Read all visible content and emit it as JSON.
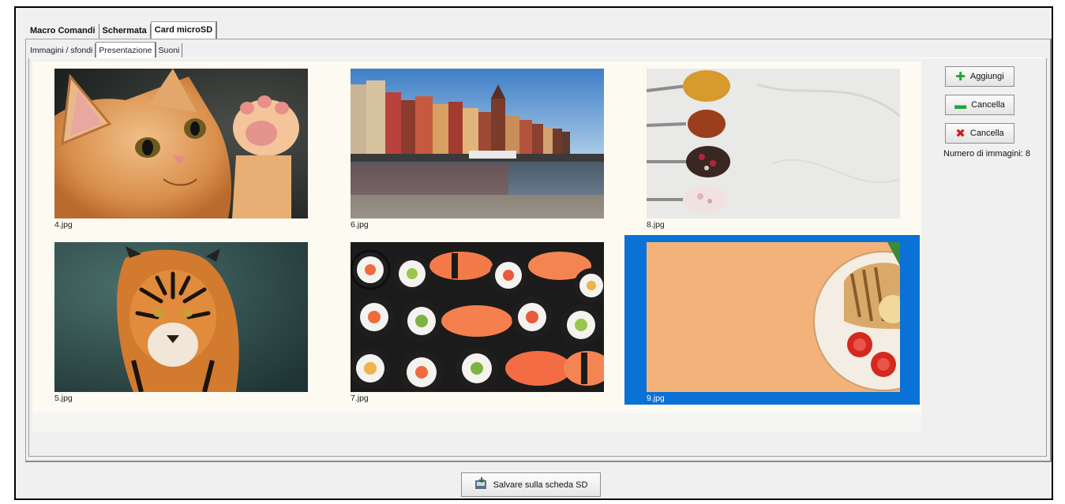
{
  "outer_tabs": [
    "Macro Comandi",
    "Schermata",
    "Card microSD"
  ],
  "inner_tabs": [
    "Immagini / sfondi",
    "Presentazione",
    "Suoni"
  ],
  "images": [
    {
      "file": "4.jpg",
      "subject": "kitten"
    },
    {
      "file": "6.jpg",
      "subject": "canal city"
    },
    {
      "file": "8.jpg",
      "subject": "spices on spoons"
    },
    {
      "file": "5.jpg",
      "subject": "tiger"
    },
    {
      "file": "7.jpg",
      "subject": "sushi"
    },
    {
      "file": "9.jpg",
      "subject": "food plate",
      "selected": true
    }
  ],
  "buttons": {
    "add": "Aggiungi",
    "remove": "Cancella",
    "delete": "Cancella",
    "save": "Salvare sulla scheda SD"
  },
  "count_label": "Numero di immagini: 8",
  "icons": {
    "add": "plus-icon",
    "remove": "minus-icon",
    "delete": "x-icon",
    "save": "sd-card-save-icon"
  },
  "colors": {
    "selection": "#0a71d6",
    "add_icon": "#1ea63a",
    "remove_icon": "#1ea63a",
    "delete_icon": "#d21c1c"
  }
}
